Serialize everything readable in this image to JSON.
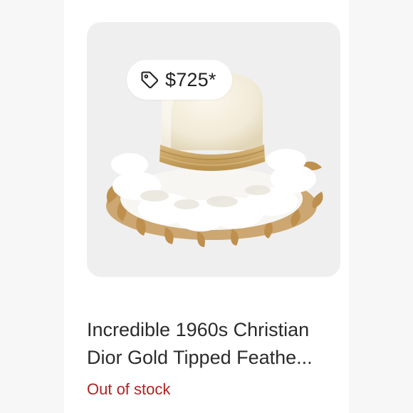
{
  "listing": {
    "price": "$725*",
    "price_icon": "price-tag-icon",
    "title_line1": "Incredible 1960s Christian",
    "title_line2": "Dior Gold Tipped Feathe...",
    "status": "Out of stock"
  },
  "colors": {
    "status": "#b22222",
    "tile_background": "#efefef"
  }
}
